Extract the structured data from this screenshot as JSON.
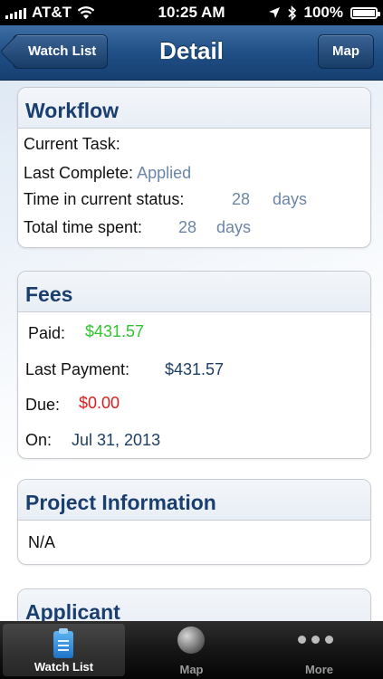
{
  "status_bar": {
    "carrier": "AT&T",
    "time": "10:25 AM",
    "battery": "100%",
    "battery_level": 1.0
  },
  "nav": {
    "back_label": "Watch List",
    "title": "Detail",
    "right_button": "Map"
  },
  "workflow": {
    "title": "Workflow",
    "current_task_label": "Current Task:",
    "last_complete_label": "Last Complete:",
    "last_complete_value": "Applied",
    "time_in_status_label": "Time in current status:",
    "time_in_status_value": "28",
    "time_in_status_unit": "days",
    "total_time_label": "Total time spent:",
    "total_time_value": "28",
    "total_time_unit": "days"
  },
  "fees": {
    "title": "Fees",
    "paid_label": "Paid:",
    "paid_value": "$431.57",
    "last_payment_label": "Last Payment:",
    "last_payment_value": "$431.57",
    "due_label": "Due:",
    "due_value": "$0.00",
    "on_label": "On:",
    "on_value": "Jul 31, 2013"
  },
  "project_info": {
    "title": "Project Information",
    "value": "N/A"
  },
  "applicant": {
    "title": "Applicant"
  },
  "tabs": [
    {
      "label": "Watch List",
      "icon": "clipboard-icon",
      "active": true
    },
    {
      "label": "Map",
      "icon": "globe-icon",
      "active": false
    },
    {
      "label": "More",
      "icon": "more-dots-icon",
      "active": false
    }
  ],
  "colors": {
    "nav_blue": "#1f4f86",
    "title_blue": "#1a3e6e",
    "paid_green": "#2ec52e",
    "due_red": "#e01b1b"
  }
}
